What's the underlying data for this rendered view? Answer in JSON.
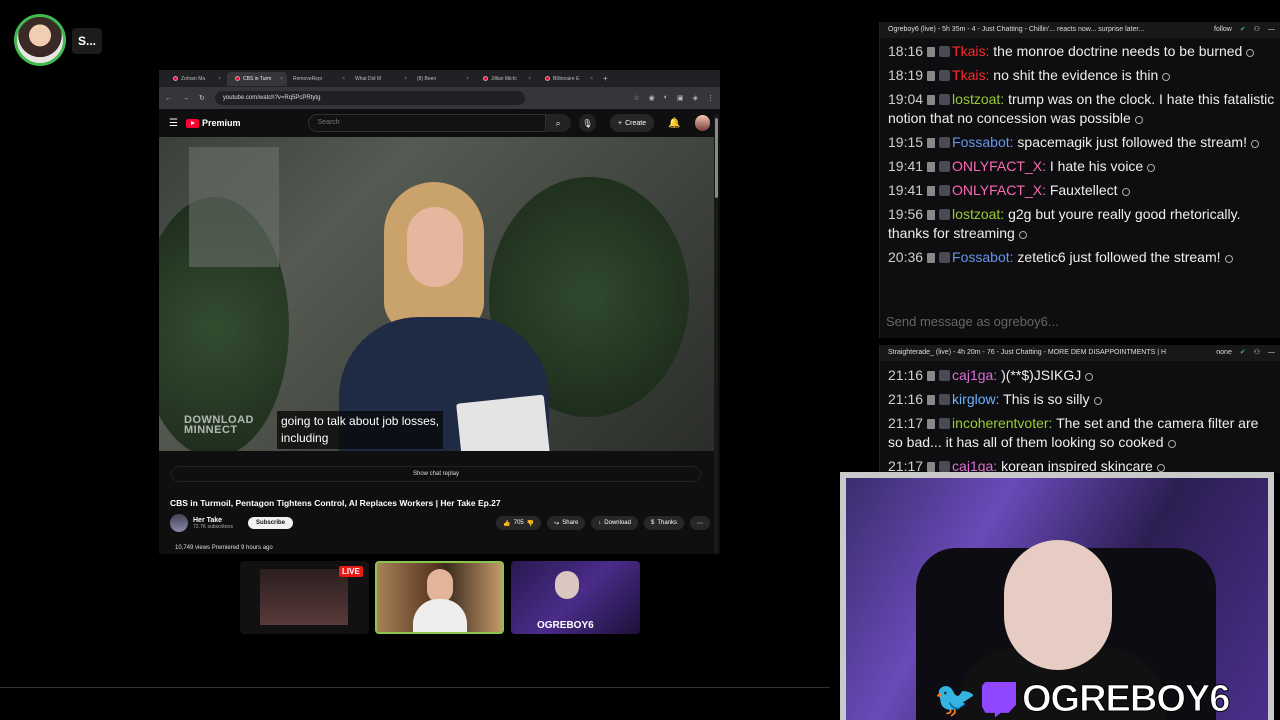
{
  "streamer_tag": "S...",
  "browser": {
    "tabs": [
      "Zohran Ma",
      "CBS in Turm",
      "RemoveRepi",
      "What Did M",
      "(8) Been",
      "Jillian Michi",
      "Billionaire E"
    ],
    "url": "youtube.com/watch?v=Rq5PcPRtytg"
  },
  "youtube": {
    "logo_text": "Premium",
    "search_placeholder": "Search",
    "create_label": "Create",
    "caption_line1": "going to talk about job losses,",
    "caption_line2": "including",
    "watermark_line1": "DOWNLOAD",
    "watermark_line2": "MINNECT",
    "show_chat_replay": "Show chat replay",
    "title": "CBS in Turmoil, Pentagon Tightens Control, AI Replaces Workers | Her Take Ep.27",
    "channel_name": "Her Take",
    "channel_subs": "72.7K subscribers",
    "subscribe_label": "Subscribe",
    "likes": "705",
    "share_label": "Share",
    "download_label": "Download",
    "thanks_label": "Thanks",
    "meta": "10,749 views  Premiered 9 hours ago"
  },
  "thumbnails": {
    "live_badge": "LIVE",
    "thumb3_label": "OGREBOY6"
  },
  "chat1": {
    "header": "Ogreboy6 (live) - 5h 35m - 4 - Just Chatting - Chillin'... reacts now... surprise later...",
    "follow_label": "follow",
    "send_placeholder": "Send message as ogreboy6...",
    "messages": [
      {
        "time": "18:16",
        "user": "Tkais:",
        "color": "#ff2a2a",
        "text": "the monroe doctrine needs to be burned"
      },
      {
        "time": "18:19",
        "user": "Tkais:",
        "color": "#ff2a2a",
        "text": "no shit the evidence is thin"
      },
      {
        "time": "19:04",
        "user": "lostzoat:",
        "color": "#9acd32",
        "text": "trump was on the clock. I hate this fatalistic notion that no concession was possible"
      },
      {
        "time": "19:15",
        "user": "Fossabot:",
        "color": "#6495ed",
        "text": "spacemagik just followed the stream!"
      },
      {
        "time": "19:41",
        "user": "ONLYFACT_X:",
        "color": "#ff69b4",
        "text": "I hate his voice"
      },
      {
        "time": "19:41",
        "user": "ONLYFACT_X:",
        "color": "#ff69b4",
        "text": "Fauxtellect"
      },
      {
        "time": "19:56",
        "user": "lostzoat:",
        "color": "#9acd32",
        "text": "g2g but youre really good rhetorically. thanks for streaming"
      },
      {
        "time": "20:36",
        "user": "Fossabot:",
        "color": "#6495ed",
        "text": "zetetic6 just followed the stream!"
      }
    ]
  },
  "chat2": {
    "header": "Straighterade_ (live) - 4h 20m - 76 - Just Chatting - MORE DEM DISAPPOINTMENTS | H",
    "follow_label": "none",
    "messages": [
      {
        "time": "21:16",
        "user": "caj1ga:",
        "color": "#da70d6",
        "text": ")(**$)JSIKGJ"
      },
      {
        "time": "21:16",
        "user": "kirglow:",
        "color": "#6cb4ff",
        "text": "This is so silly"
      },
      {
        "time": "21:17",
        "user": "incoherentvoter:",
        "color": "#9acd32",
        "text": "The set and the camera filter are so bad... it has all of them looking so cooked"
      },
      {
        "time": "21:17",
        "user": "caj1ga:",
        "color": "#da70d6",
        "text": "korean inspired skincare"
      }
    ]
  },
  "webcam": {
    "name": "OGREBOY6"
  }
}
